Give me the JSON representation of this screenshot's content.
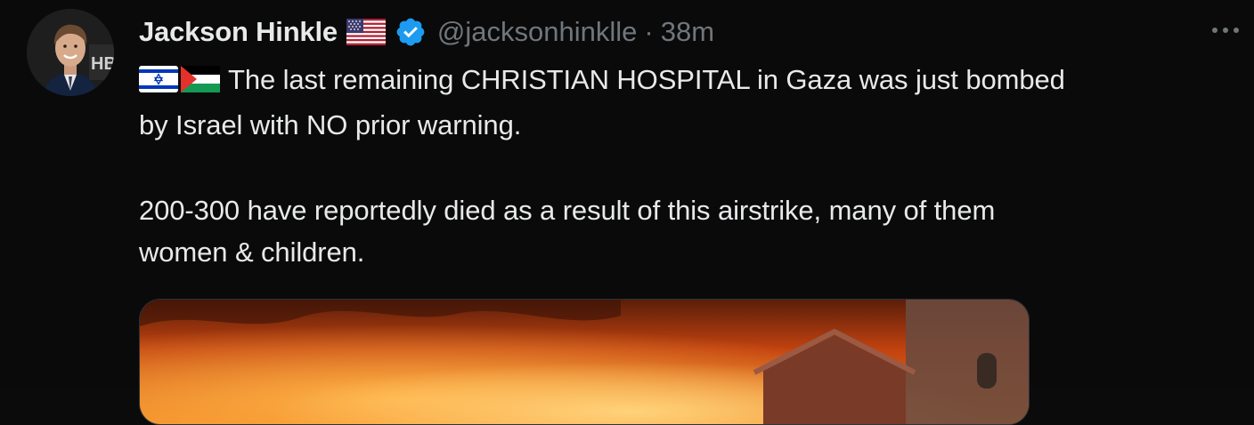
{
  "tweet": {
    "author_name": "Jackson Hinkle",
    "handle": "@jacksonhinklle",
    "separator": "·",
    "time": "38m",
    "text_line1": "The last remaining CHRISTIAN HOSPITAL in Gaza was just bombed",
    "text_line2": "by Israel with NO prior warning.",
    "text_line3": "200-300 have reportedly died as a result of this airstrike, many of them",
    "text_line4": "women & children.",
    "avatar_badge": "HB"
  },
  "icons": {
    "author_flag": "us-flag-icon",
    "verified": "verified-badge-icon",
    "more": "more-options-icon",
    "text_flags": [
      "israel-flag-icon",
      "palestine-flag-icon"
    ]
  },
  "colors": {
    "background": "#0a0a0a",
    "text": "#e7e9ea",
    "secondary_text": "#71767b",
    "verified_blue": "#1d9bf0"
  }
}
